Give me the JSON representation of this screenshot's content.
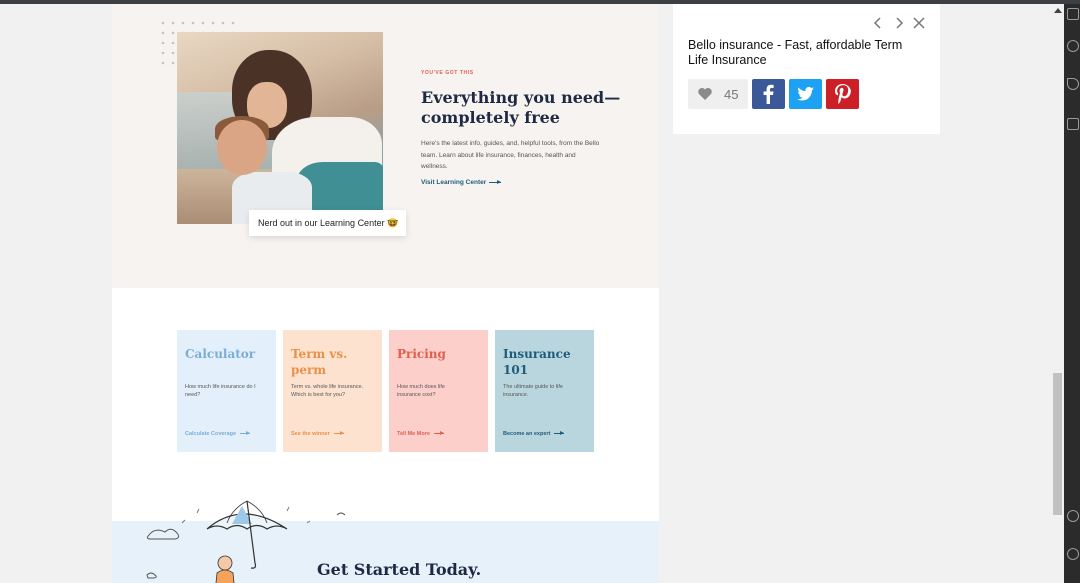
{
  "hero": {
    "eyebrow": "YOU'VE GOT THIS",
    "headline": "Everything you need—completely free",
    "body": "Here's the latest info, guides, and, helpful tools, from the Bello team. Learn about life insurance, finances, health and wellness.",
    "link": "Visit Learning Center",
    "callout": "Nerd out in our Learning Center 🤓"
  },
  "cards": [
    {
      "title": "Calculator",
      "desc": "How much life insurance do I need?",
      "link": "Calculate Coverage",
      "bg": "#e3f0fb",
      "accent": "#7aaed6"
    },
    {
      "title": "Term vs. perm",
      "desc": "Term vs. whole life insurance. Which is best for you?",
      "link": "See the winner",
      "bg": "#fde3cf",
      "accent": "#e8914a"
    },
    {
      "title": "Pricing",
      "desc": "How much does life insurance cost?",
      "link": "Tell Me More",
      "bg": "#fdcfcb",
      "accent": "#e0604c"
    },
    {
      "title": "Insurance 101",
      "desc": "The ultimate guide to life insurance.",
      "link": "Become an expert",
      "bg": "#b9d6de",
      "accent": "#1f5c7a"
    }
  ],
  "get_started": {
    "title": "Get Started Today."
  },
  "pin": {
    "title": "Bello insurance - Fast, affordable Term Life Insurance",
    "like_count": "45",
    "icons": [
      "chevron-left-icon",
      "chevron-right-icon",
      "close-icon",
      "heart-icon",
      "facebook-icon",
      "twitter-icon",
      "pinterest-icon"
    ]
  }
}
